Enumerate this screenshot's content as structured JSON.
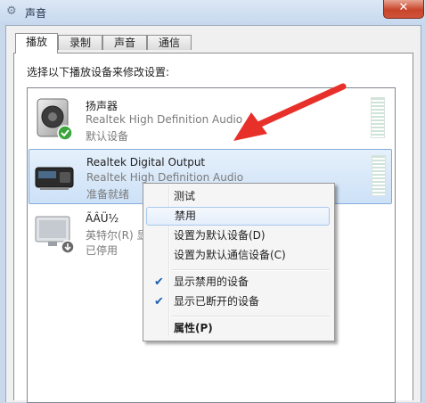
{
  "window": {
    "title": "声音",
    "close_label": "✕"
  },
  "tabs": [
    {
      "label": "播放",
      "active": true
    },
    {
      "label": "录制",
      "active": false
    },
    {
      "label": "声音",
      "active": false
    },
    {
      "label": "通信",
      "active": false
    }
  ],
  "instruction": "选择以下播放设备来修改设置:",
  "devices": [
    {
      "name": "扬声器",
      "description": "Realtek High Definition Audio",
      "status": "默认设备",
      "icon": "speaker-icon"
    },
    {
      "name": "Realtek Digital Output",
      "description": "Realtek High Definition Audio",
      "status": "准备就绪",
      "icon": "digital-output-icon"
    },
    {
      "name": "ÃÂÜ½",
      "description": "英特尔(R) 显",
      "status": "已停用",
      "icon": "monitor-icon"
    }
  ],
  "context_menu": {
    "items": [
      {
        "label": "测试",
        "checked": false
      },
      {
        "label": "禁用",
        "checked": false
      },
      {
        "label": "设置为默认设备(D)",
        "checked": false
      },
      {
        "label": "设置为默认通信设备(C)",
        "checked": false
      },
      {
        "label": "显示禁用的设备",
        "checked": true
      },
      {
        "label": "显示已断开的设备",
        "checked": true
      },
      {
        "label": "属性(P)",
        "checked": false
      }
    ]
  },
  "colors": {
    "accent_arrow": "#e8302a",
    "selection": "#cde1f7",
    "check_mark": "#1d5fb4"
  }
}
